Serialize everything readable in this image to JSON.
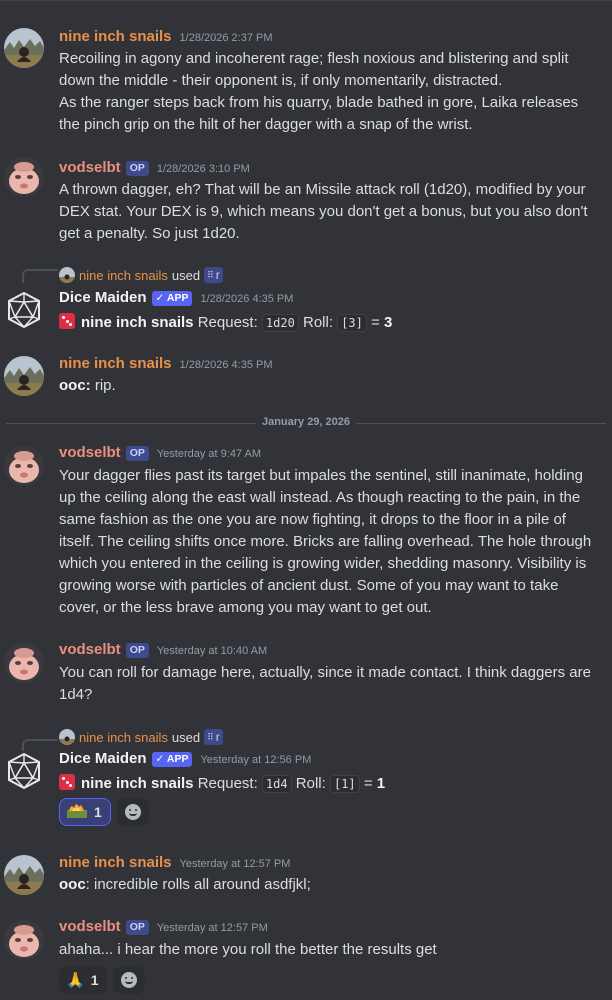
{
  "messages": [
    {
      "user": "nine inch snails",
      "timestamp": "1/28/2026 2:37 PM",
      "lines": [
        "Recoiling in agony and incoherent rage; flesh noxious and blistering and split",
        "down the middle - their opponent is, if only momentarily, distracted.",
        "As the ranger steps back from his quarry, blade bathed in gore, Laika releases",
        "the pinch grip on the hilt of her dagger with a snap of the wrist."
      ]
    },
    {
      "user": "vodselbt",
      "badge": "OP",
      "timestamp": "1/28/2026 3:10 PM",
      "lines": [
        "A thrown dagger, eh? That will be an Missile attack roll (1d20),  modified by your",
        "DEX stat. Your DEX is 9, which means you don't get a bonus, but you also don't",
        "get a penalty. So just 1d20."
      ]
    },
    {
      "reply_user": "nine inch snails",
      "reply_used": "used",
      "reply_cmd": "r",
      "user": "Dice Maiden",
      "badge": "APP",
      "timestamp": "1/28/2026 4:35 PM",
      "roll_user": "nine inch snails",
      "request_label": "Request:",
      "request": "1d20",
      "roll_label": "Roll:",
      "roll": "[3]",
      "eq": "=",
      "result": "3"
    },
    {
      "user": "nine inch snails",
      "timestamp": "1/28/2026 4:35 PM",
      "ooc": "ooc:",
      "text": " rip."
    },
    {
      "user": "vodselbt",
      "badge": "OP",
      "timestamp": "Yesterday at 9:47 AM",
      "lines": [
        "Your dagger flies past its target but impales the sentinel, still inanimate, holding",
        "up the ceiling along the east wall instead. As though reacting to the pain, in the",
        "same fashion as the one you are now fighting, it drops to the floor in a pile of",
        "itself. The ceiling shifts once more. Bricks are falling overhead. The hole through",
        "which you entered in the ceiling is growing wider, shedding masonry. Visibility is",
        "growing worse with particles of ancient dust. Some of you may want to take",
        "cover, or the less brave among you  may want to get out."
      ]
    },
    {
      "user": "vodselbt",
      "badge": "OP",
      "timestamp": "Yesterday at 10:40 AM",
      "lines": [
        "You can roll for damage here, actually, since it made contact. I think daggers are",
        "1d4?"
      ]
    },
    {
      "reply_user": "nine inch snails",
      "reply_used": "used",
      "reply_cmd": "r",
      "user": "Dice Maiden",
      "badge": "APP",
      "timestamp": "Yesterday at 12:56 PM",
      "roll_user": "nine inch snails",
      "request_label": "Request:",
      "request": "1d4",
      "roll_label": "Roll:",
      "roll": "[1]",
      "eq": "=",
      "result": "1",
      "reaction_count": "1",
      "reaction_emoji": "dumpster-fire-emoji"
    },
    {
      "user": "nine inch snails",
      "timestamp": "Yesterday at 12:57 PM",
      "ooc": "ooc",
      "text": ": incredible rolls all around asdfjkl;"
    },
    {
      "user": "vodselbt",
      "badge": "OP",
      "timestamp": "Yesterday at 12:57 PM",
      "text": "ahaha... i hear the more you roll the better the results get",
      "reaction_emoji": "🙏",
      "reaction_count": "1"
    }
  ],
  "divider": "January 29, 2026",
  "colors": {
    "background": "#323339",
    "op_badge": "#3e4a8a",
    "app_badge": "#5865f2",
    "orange_name": "#e8914a",
    "pink_name": "#ec8f7e"
  }
}
